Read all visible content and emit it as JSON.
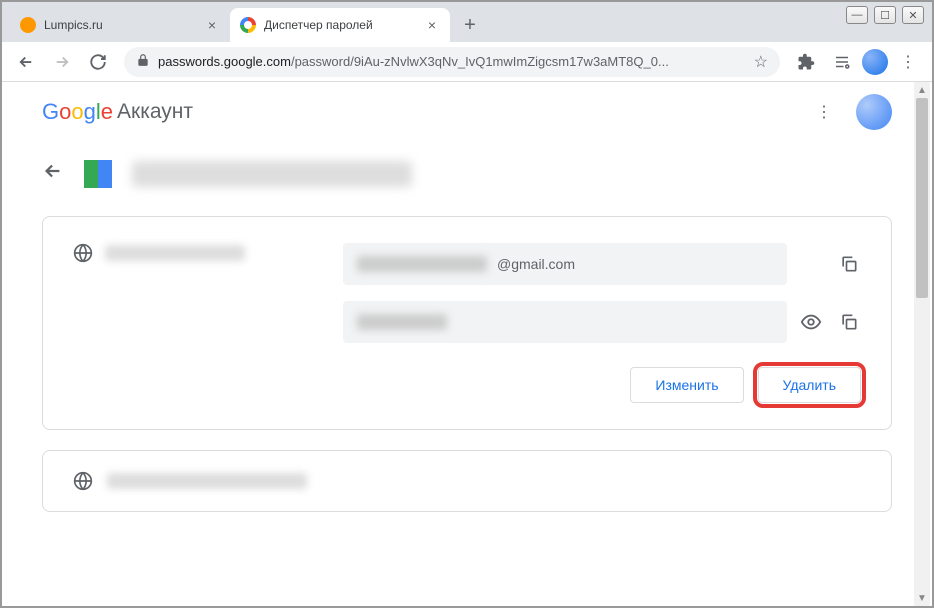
{
  "tabs": [
    {
      "title": "Lumpics.ru",
      "favicon_color": "#ff9800"
    },
    {
      "title": "Диспетчер паролей",
      "favicon_type": "google"
    }
  ],
  "url": {
    "domain": "passwords.google.com",
    "path": "/password/9iAu-zNvlwX3qNv_IvQ1mwImZigcsm17w3aMT8Q_0..."
  },
  "google_logo": {
    "g": "G",
    "o1": "o",
    "o2": "o",
    "g2": "g",
    "l": "l",
    "e": "e",
    "account": "Аккаунт"
  },
  "site": {
    "domain_blurred": true
  },
  "credential": {
    "email_suffix": "@gmail.com",
    "password_masked": true
  },
  "buttons": {
    "edit": "Изменить",
    "delete": "Удалить"
  },
  "icons": {
    "back": "←",
    "new_tab": "+",
    "close": "×",
    "minimize": "—",
    "maximize": "☐",
    "win_close": "✕",
    "star": "☆",
    "menu_dots": "⋮"
  }
}
